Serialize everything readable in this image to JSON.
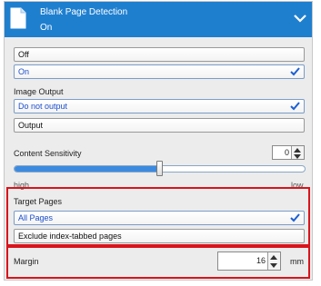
{
  "header": {
    "title": "Blank Page Detection",
    "value": "On",
    "icons": {
      "document": "document-icon",
      "collapse": "chevron-down-icon"
    }
  },
  "detection_options": [
    {
      "label": "Off",
      "selected": false
    },
    {
      "label": "On",
      "selected": true
    }
  ],
  "image_output": {
    "label": "Image Output",
    "options": [
      {
        "label": "Do not output",
        "selected": true
      },
      {
        "label": "Output",
        "selected": false
      }
    ]
  },
  "content_sensitivity": {
    "label": "Content Sensitivity",
    "value": "0",
    "slider_fraction": 0.5,
    "left_label": "high",
    "right_label": "low"
  },
  "target_pages": {
    "label": "Target Pages",
    "options": [
      {
        "label": "All Pages",
        "selected": true
      },
      {
        "label": "Exclude index-tabbed pages",
        "selected": false
      }
    ]
  },
  "margin": {
    "label": "Margin",
    "value": "16",
    "unit": "mm"
  },
  "colors": {
    "header_bg": "#1f7fcf",
    "selected_text": "#1b4fcf",
    "highlight": "#d9141b",
    "slider_fill": "#3b8ae0"
  }
}
